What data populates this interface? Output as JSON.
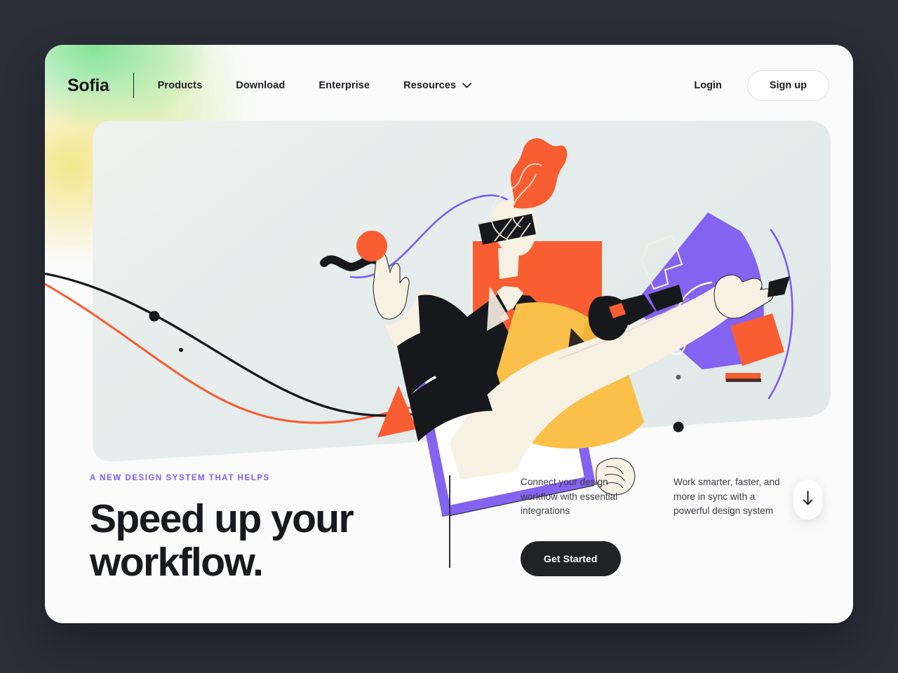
{
  "theme": {
    "page_background": "#2b2e38",
    "card_background": "#fbfbfb",
    "hero_panel": "#e3ebea",
    "accent_purple": "#7b5cf5",
    "accent_orange": "#f95d32",
    "accent_yellow": "#fbc04a",
    "ink": "#18191d",
    "skin": "#f7f1e3"
  },
  "nav": {
    "brand": "Sofia",
    "links": [
      {
        "label": "Products",
        "icon": ""
      },
      {
        "label": "Download",
        "icon": ""
      },
      {
        "label": "Enterprise",
        "icon": ""
      },
      {
        "label": "Resources",
        "icon": "chevron-down-icon"
      }
    ],
    "login_label": "Login",
    "signup_label": "Sign up"
  },
  "hero": {
    "illustration_name": "vr-designer-illustration",
    "eyebrow": "A new design system that helps",
    "headline_line1": "Speed up your",
    "headline_line2": "workflow.",
    "blurbs": [
      "Connect your design workflow with essential integrations",
      "Work smarter, faster, and more in sync with a powerful design system"
    ],
    "cta_label": "Get Started",
    "scroll_icon": "arrow-down-icon"
  }
}
